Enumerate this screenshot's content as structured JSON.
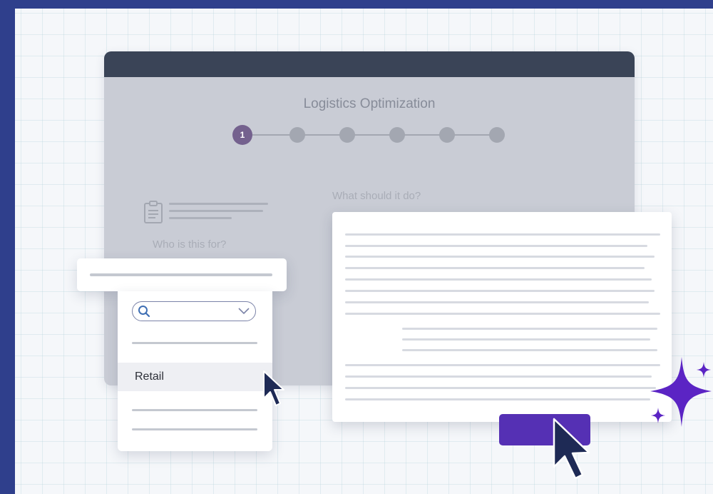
{
  "window": {
    "title": "Logistics Optimization",
    "steps": [
      "1",
      "",
      "",
      "",
      "",
      ""
    ],
    "question_what": "What should it do?",
    "question_who": "Who is this for?"
  },
  "dropdown": {
    "search_placeholder": "",
    "selected_option": "Retail"
  },
  "colors": {
    "page_border": "#2f3f8c",
    "titlebar": "#3a4457",
    "active_step": "#74618e",
    "button": "#5530b4",
    "sparkle": "#5b24c4",
    "cursor": "#1e2a55"
  },
  "icons": [
    "clipboard-icon",
    "search-icon",
    "chevron-down-icon",
    "cursor-arrow-icon",
    "sparkle-icon"
  ]
}
